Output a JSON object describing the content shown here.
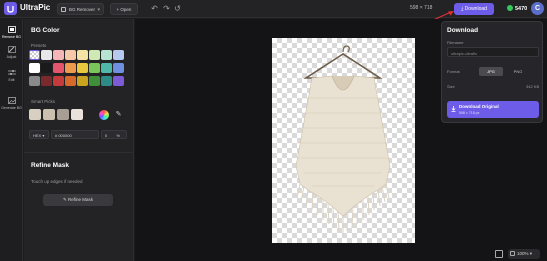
{
  "header": {
    "app_title": "UltraPic",
    "tool_select": "BG Remover",
    "open_label": "+ Open",
    "dimensions": "598 × 718",
    "download_label": "Download",
    "credits": "5470",
    "avatar_initial": "C"
  },
  "rail": {
    "items": [
      {
        "label": "Remove BG"
      },
      {
        "label": "Adjust"
      },
      {
        "label": "Edit"
      },
      {
        "label": "Generate BG"
      }
    ]
  },
  "panel": {
    "bg_color_title": "BG Color",
    "presets_label": "Presets",
    "preset_colors": [
      [
        "transparent",
        "#e8e8e8",
        "#f4b6b6",
        "#f7c9a8",
        "#f5e3a3",
        "#cfe9b4",
        "#b7e3d2",
        "#b8c9f0"
      ],
      [
        "#ffffff",
        "#1a1a1a",
        "#e5556e",
        "#ee9b4d",
        "#e9c840",
        "#7bc65a",
        "#4fb8a8",
        "#6f8fe0"
      ],
      [
        "#8a8a8a",
        "#7a2a2a",
        "#c43b3b",
        "#d76a2a",
        "#c9a21f",
        "#3f8f3a",
        "#2d8a84",
        "#7c5bd4"
      ]
    ],
    "smart_picks_label": "Smart Picks",
    "smart_picks": [
      "#d8cfc3",
      "#cbbfb0",
      "#a89e93",
      "#e8e2da"
    ],
    "hex_label": "HEX",
    "hex_value": "# 000000",
    "opacity_value": "0",
    "opacity_unit": "%",
    "refine_title": "Refine Mask",
    "refine_hint": "Touch up edges if needed",
    "refine_button": "Refine Mask"
  },
  "canvas": {
    "zoom": "100%"
  },
  "popup": {
    "title": "Download",
    "filename_label": "Filename",
    "filename_placeholder": "ultrapic-ultrafix",
    "format_label": "Format",
    "format_options": [
      "JPG",
      "PNG"
    ],
    "format_selected": "JPG",
    "size_label": "Size",
    "size_value": "342 KB",
    "download_original_label": "Download Original",
    "download_original_sub": "598 × 718 px"
  },
  "colors": {
    "accent": "#6c5ce7",
    "background": "#1c1c1e",
    "canvas": "#141416"
  }
}
